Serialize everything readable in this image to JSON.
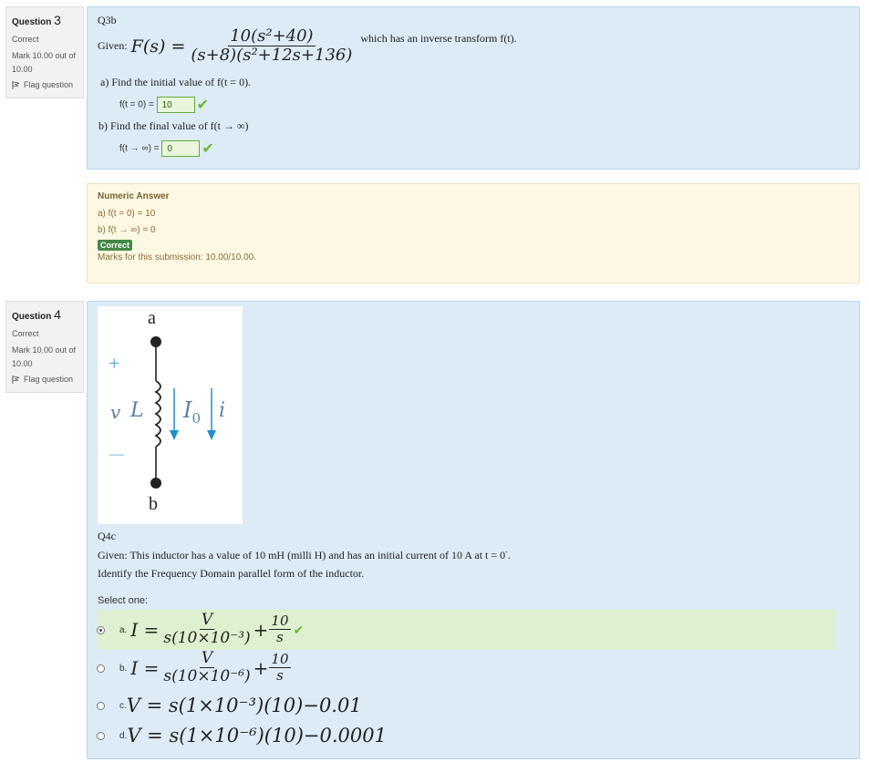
{
  "q3": {
    "info": {
      "label": "Question",
      "number": "3",
      "status": "Correct",
      "mark_line1": "Mark 10.00 out of",
      "mark_line2": "10.00",
      "flag": "Flag question"
    },
    "title": "Q3b",
    "given": "Given:",
    "f_lhs": "F(s) =",
    "f_num": "10(s²+40)",
    "f_den": "(s+8)(s²+12s+136)",
    "given_tail": "which has an inverse transform f(t).",
    "part_a": "a)  Find the initial value of f(t = 0).",
    "a_label": "f(t = 0) =",
    "a_value": "10",
    "part_b": "b)  Find the final value of f(t → ∞)",
    "b_label": "f(t → ∞) =",
    "b_value": "0",
    "feedback": {
      "title": "Numeric Answer",
      "line_a": "a) f(t = 0) = 10",
      "line_b": "b) f(t → ∞) = 0",
      "badge": "Correct",
      "marks": "Marks for this submission: 10.00/10.00."
    }
  },
  "q4": {
    "info": {
      "label": "Question",
      "number": "4",
      "status": "Correct",
      "mark_line1": "Mark 10.00 out of",
      "mark_line2": "10.00",
      "flag": "Flag question"
    },
    "diagram": {
      "top": "a",
      "bottom": "b",
      "plus": "+",
      "minus": "—",
      "v": "v",
      "L": "L",
      "I0": "I",
      "I0_sub": "0",
      "i": "i"
    },
    "title": "Q4c",
    "given": "Given: This inductor has a value of 10 mH (milli H) and has an initial current of 10 A at t = 0",
    "given_sup": "-",
    "given_end": ".",
    "instruction": "Identify the Frequency Domain parallel form of the inductor.",
    "select_one": "Select one:",
    "options": [
      {
        "letter": "a.",
        "lhs": "I =",
        "num": "V",
        "den": "s(10×10⁻³)",
        "plus": "+",
        "num2": "10",
        "den2": "s",
        "selected": true
      },
      {
        "letter": "b.",
        "lhs": "I =",
        "num": "V",
        "den": "s(10×10⁻⁶)",
        "plus": "+",
        "num2": "10",
        "den2": "s",
        "selected": false
      },
      {
        "letter": "c.",
        "expr": "V = s(1×10⁻³)(10)−0.01",
        "selected": false
      },
      {
        "letter": "d.",
        "expr": "V = s(1×10⁻⁶)(10)−0.0001",
        "selected": false
      }
    ]
  },
  "colors": {
    "question_bg": "#dcebf5",
    "feedback_bg": "#fcf8e3",
    "correct_green": "#468847",
    "selected_bg": "#def0cf",
    "diagram_blue": "#1f8fd1"
  },
  "icons": {
    "flag": "flag-icon",
    "check": "check-icon"
  }
}
